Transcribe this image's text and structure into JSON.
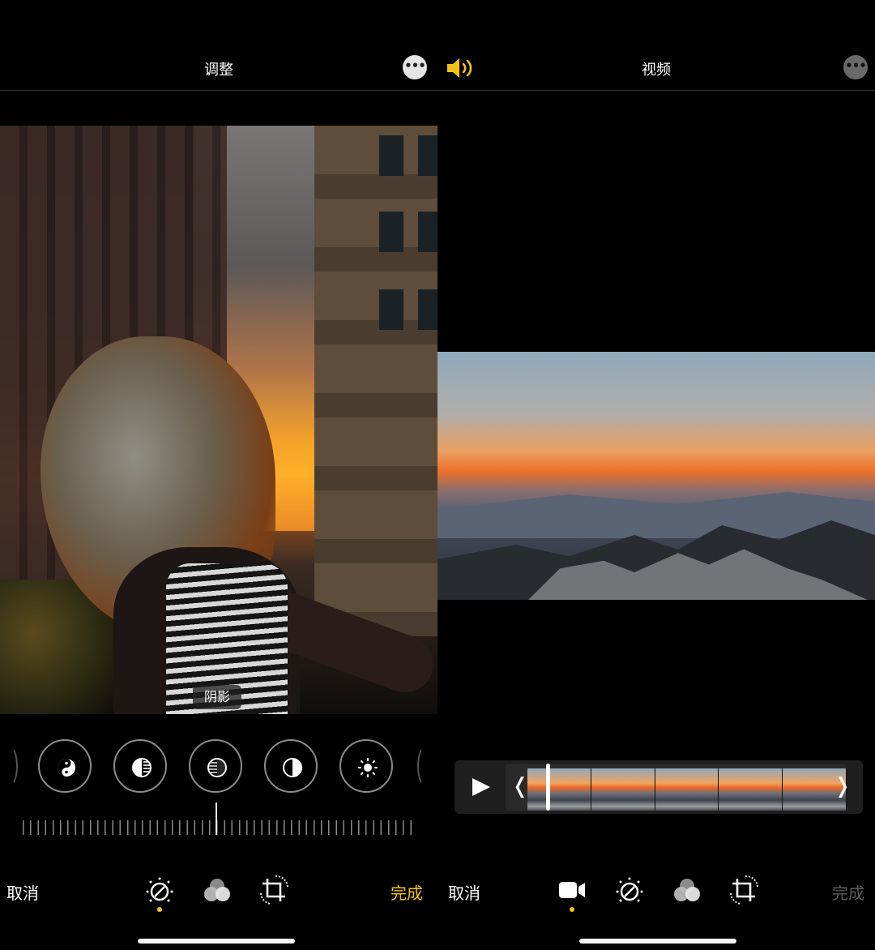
{
  "left_panel": {
    "title": "调整",
    "photo_overlay_label": "阴影",
    "cancel_label": "取消",
    "done_label": "完成",
    "colors": {
      "done": "#f5c317",
      "active_dot": "#f5c317"
    },
    "adjust_tools": [
      "exposure-icon",
      "brilliance-icon",
      "highlights-icon",
      "shadows-icon",
      "brightness-icon"
    ],
    "tool_tabs": [
      "adjust-icon",
      "filters-icon",
      "crop-icon"
    ],
    "active_tab": "adjust-icon"
  },
  "right_panel": {
    "title": "视频",
    "cancel_label": "取消",
    "done_label": "完成",
    "colors": {
      "speaker": "#f5c317",
      "done": "#5c5c5c",
      "active_dot": "#f5c317"
    },
    "tool_tabs": [
      "video-camera-icon",
      "adjust-icon",
      "filters-icon",
      "crop-icon"
    ],
    "active_tab": "video-camera-icon"
  }
}
